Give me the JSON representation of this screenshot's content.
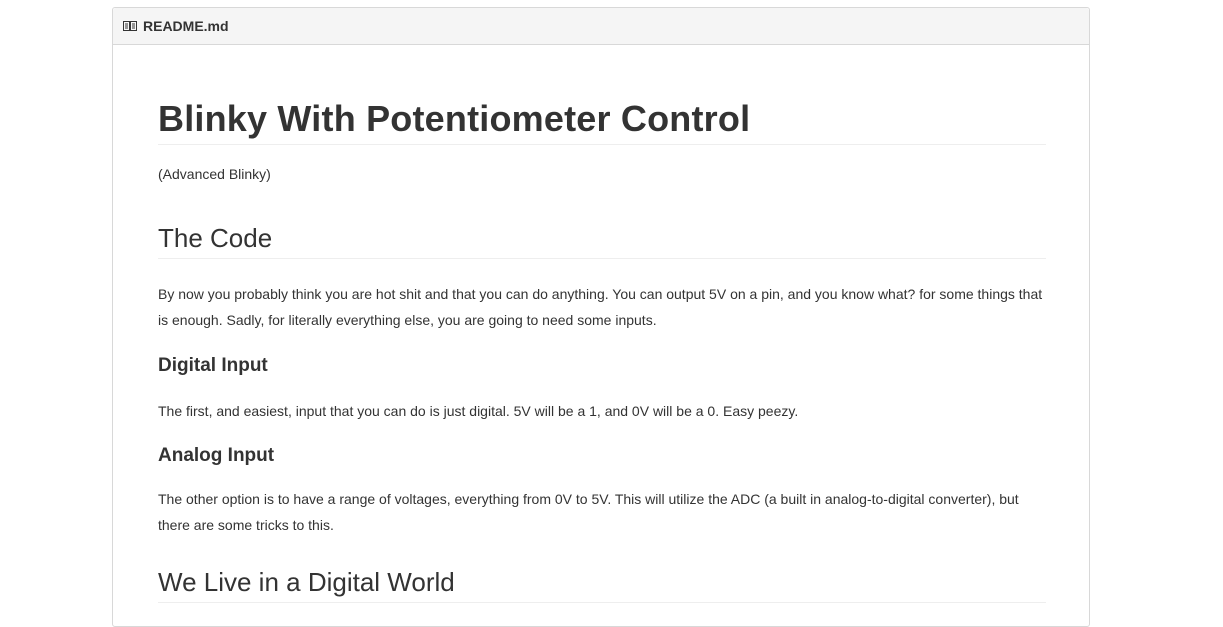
{
  "header": {
    "filename": "README.md",
    "icon": "book-icon"
  },
  "article": {
    "title": "Blinky With Potentiometer Control",
    "subtitle": "(Advanced Blinky)",
    "sections": [
      {
        "heading": "The Code",
        "paragraph": "By now you probably think you are hot shit and that you can do anything. You can output 5V on a pin, and you know what? for some things that is enough. Sadly, for literally everything else, you are going to need some inputs."
      },
      {
        "heading": "Digital Input",
        "paragraph": "The first, and easiest, input that you can do is just digital. 5V will be a 1, and 0V will be a 0. Easy peezy."
      },
      {
        "heading": "Analog Input",
        "paragraph": "The other option is to have a range of voltages, everything from 0V to 5V. This will utilize the ADC (a built in analog-to-digital converter), but there are some tricks to this."
      },
      {
        "heading": "We Live in a Digital World"
      }
    ]
  }
}
